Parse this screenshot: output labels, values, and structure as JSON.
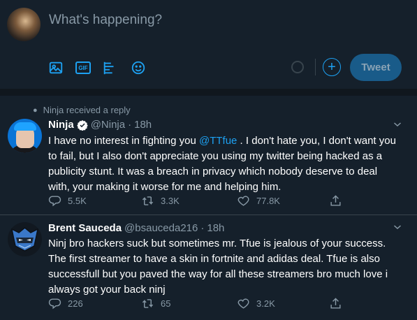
{
  "compose": {
    "placeholder": "What's happening?",
    "gif_label": "GIF",
    "tweet_button": "Tweet",
    "add_label": "+"
  },
  "tweets": [
    {
      "social_context": "Ninja received a reply",
      "name": "Ninja",
      "handle": "@Ninja",
      "separator": "·",
      "time": "18h",
      "text_before": "I have no interest in fighting you ",
      "mention": "@TTfue",
      "text_after": " . I don't hate you, I don't want you to fail, but I also don't appreciate you using my twitter being hacked as a publicity stunt. It was a breach in privacy which nobody deserve to deal with, your making it worse for me and helping him.",
      "replies": "5.5K",
      "retweets": "3.3K",
      "likes": "77.8K"
    },
    {
      "name": "Brent Sauceda",
      "handle": "@bsauceda216",
      "separator": "·",
      "time": "18h",
      "text": "Ninj bro hackers suck but sometimes mr. Tfue is jealous of your success. The first streamer to have a skin in fortnite and adidas deal. Tfue is also successfull but you paved the way for all these streamers bro much love i always got your back ninj",
      "replies": "226",
      "retweets": "65",
      "likes": "3.2K"
    }
  ],
  "colors": {
    "background": "#15202b",
    "accent": "#1da1f2",
    "muted_text": "#8899a6",
    "border": "#38444d"
  }
}
